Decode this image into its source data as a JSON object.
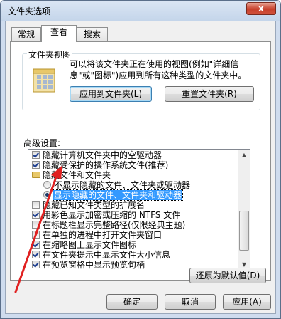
{
  "window": {
    "title": "文件夹选项",
    "close_label": "x"
  },
  "tabs": [
    {
      "label": "常规"
    },
    {
      "label": "查看",
      "active": true
    },
    {
      "label": "搜索"
    }
  ],
  "folder_views": {
    "title": "文件夹视图",
    "description_line1": "可以将该文件夹正在使用的视图(例如\"详细信",
    "description_line2": "息\"或\"图标\")应用到所有这种类型的文件夹中。",
    "apply_button": "应用到文件夹(L)",
    "reset_button": "重置文件夹(R)"
  },
  "advanced": {
    "label": "高级设置:",
    "items": [
      {
        "type": "checkbox",
        "checked": true,
        "label": "隐藏计算机文件夹中的空驱动器"
      },
      {
        "type": "checkbox",
        "checked": true,
        "label": "隐藏受保护的操作系统文件(推荐)"
      },
      {
        "type": "folder",
        "label": "隐藏文件和文件夹"
      },
      {
        "type": "radio",
        "checked": false,
        "label": "不显示隐藏的文件、文件夹或驱动器"
      },
      {
        "type": "radio",
        "checked": true,
        "label": "显示隐藏的文件、文件夹和驱动器",
        "selected": true
      },
      {
        "type": "checkbox",
        "checked": false,
        "label": "隐藏已知文件类型的扩展名"
      },
      {
        "type": "checkbox",
        "checked": true,
        "label": "用彩色显示加密或压缩的 NTFS 文件"
      },
      {
        "type": "checkbox",
        "checked": false,
        "label": "在标题栏显示完整路径(仅限经典主题)"
      },
      {
        "type": "checkbox",
        "checked": false,
        "label": "在单独的进程中打开文件夹窗口"
      },
      {
        "type": "checkbox",
        "checked": true,
        "label": "在缩略图上显示文件图标"
      },
      {
        "type": "checkbox",
        "checked": true,
        "label": "在文件夹提示中显示文件大小信息"
      },
      {
        "type": "checkbox",
        "checked": true,
        "label": "在预览窗格中显示预览句柄"
      }
    ],
    "scroll_position_fraction": 0.55,
    "restore_defaults_button": "还原为默认值(D)"
  },
  "footer": {
    "ok_button": "确定",
    "cancel_button": "取消",
    "apply_button": "应用(A)"
  },
  "colors": {
    "selection": "#3399ff",
    "annotation_arrow": "#e02020"
  }
}
